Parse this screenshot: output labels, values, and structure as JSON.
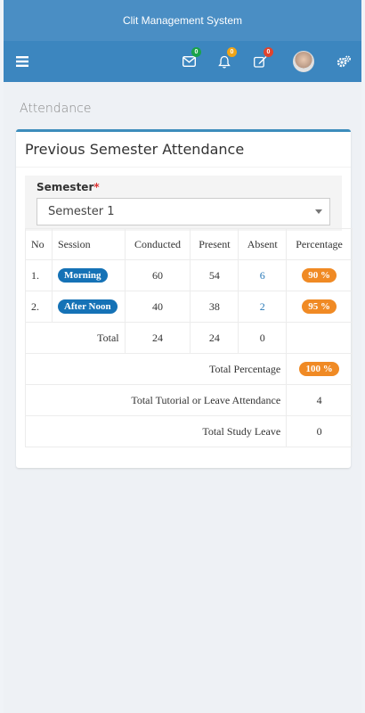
{
  "header": {
    "title": "Clit Management System"
  },
  "navbar": {
    "badges": {
      "messages": "0",
      "notifications": "0",
      "tasks": "0"
    },
    "colors": {
      "messages": "#1aa34a",
      "notifications": "#f0a417",
      "tasks": "#e0442e"
    }
  },
  "breadcrumb": "Attendance",
  "card": {
    "title": "Previous Semester Attendance",
    "semester_label": "Semester",
    "semester_required": "*",
    "semester_value": "Semester 1"
  },
  "table": {
    "headers": {
      "no": "No",
      "session": "Session",
      "conducted": "Conducted",
      "present": "Present",
      "absent": "Absent",
      "percentage": "Percentage"
    },
    "rows": [
      {
        "no": "1.",
        "session": "Morning",
        "conducted": "60",
        "present": "54",
        "absent": "6",
        "percentage": "90 %"
      },
      {
        "no": "2.",
        "session": "After Noon",
        "conducted": "40",
        "present": "38",
        "absent": "2",
        "percentage": "95 %"
      }
    ],
    "total": {
      "label": "Total",
      "conducted": "24",
      "present": "24",
      "absent": "0"
    },
    "summary": [
      {
        "label": "Total Percentage",
        "value": "100 %"
      },
      {
        "label": "Total Tutorial or Leave Attendance",
        "value": "4"
      },
      {
        "label": "Total Study Leave",
        "value": "0"
      }
    ]
  }
}
